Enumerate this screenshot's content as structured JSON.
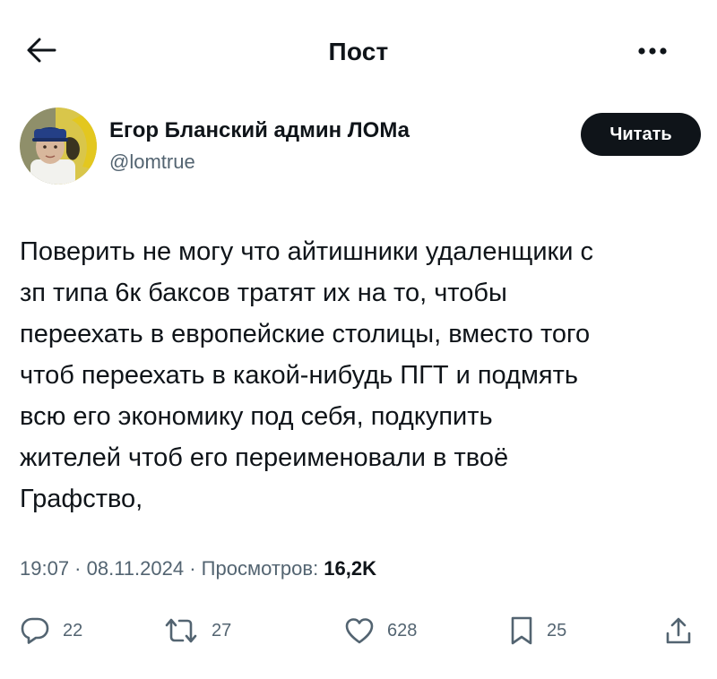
{
  "header": {
    "back_icon": "arrow-left-icon",
    "title": "Пост",
    "more_icon": "more-horizontal-icon"
  },
  "author": {
    "name": "Егор Бланский админ ЛОМа",
    "handle": "@lomtrue",
    "follow_label": "Читать",
    "avatar": "avatar-photo"
  },
  "tweet": {
    "text": "Поверить не могу что айтишники удаленщики с\nзп типа 6к баксов тратят их на то, чтобы\nпереехать в европейские столицы, вместо того\nчтоб переехать в какой-нибудь ПГТ и подмять\nвсю его экономику под себя, подкупить\nжителей чтоб его переименовали в твоё\nГрафство,"
  },
  "meta": {
    "time": "19:07",
    "separator1": " · ",
    "date": "08.11.2024",
    "separator2": " · ",
    "views_label": "Просмотров: ",
    "views_count": "16,2K"
  },
  "actions": {
    "replies": "22",
    "reposts": "27",
    "likes": "628",
    "bookmarks": "25",
    "share_icon": "share-icon"
  },
  "colors": {
    "text": "#0f1419",
    "secondary": "#536471",
    "button_bg": "#0f1419",
    "button_text": "#ffffff"
  }
}
